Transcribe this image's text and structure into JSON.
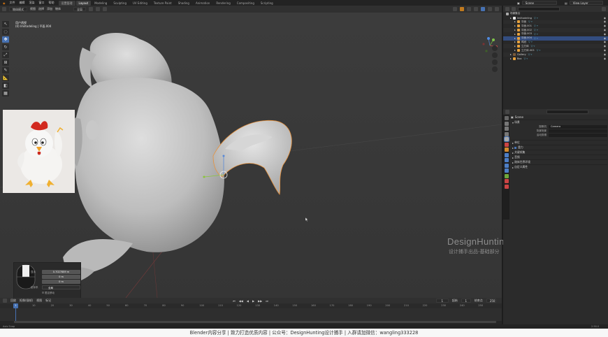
{
  "topbar": {
    "menu": [
      "文件",
      "编辑",
      "渲染",
      "窗口",
      "帮助"
    ],
    "tabs": [
      "设置管理",
      "Layout",
      "Modeling",
      "Sculpting",
      "UV Editing",
      "Texture Paint",
      "Shading",
      "Animation",
      "Rendering",
      "Compositing",
      "Scripting"
    ],
    "active_tab": "Layout",
    "scene_label": "Scene",
    "layer_label": "View Layer"
  },
  "viewport_header": {
    "mode": "物体模式",
    "menus": [
      "视图",
      "选择",
      "添加",
      "物体"
    ],
    "transform": "全局"
  },
  "viewport": {
    "info_line1": "用户透视",
    "info_line2": "(0) Imiltodeling | 平面.004",
    "watermark_title": "DesignHunting",
    "watermark_sub": "设计捕手出品-基础部分"
  },
  "op_panel": {
    "label_a": "显示",
    "value_a": "0.7027889 m",
    "value_b": "0 m",
    "value_c": "0 m",
    "label_b": "坐标系",
    "dropdown": "全局",
    "checkbox": "限定移动"
  },
  "outliner": {
    "title": "场景集合",
    "rows": [
      {
        "label": "Imiltodeling",
        "color": "#e8e8e8",
        "depth": 1
      },
      {
        "label": "平面",
        "color": "#e8a23c",
        "depth": 2
      },
      {
        "label": "平面.001",
        "color": "#e8a23c",
        "depth": 2
      },
      {
        "label": "平面.002",
        "color": "#e8a23c",
        "depth": 2
      },
      {
        "label": "平面.003",
        "color": "#e8a23c",
        "depth": 2
      },
      {
        "label": "平面.004",
        "color": "#e8a23c",
        "depth": 2,
        "selected": true
      },
      {
        "label": "鸡冠",
        "color": "#e8a23c",
        "depth": 2
      },
      {
        "label": "立方体",
        "color": "#e8a23c",
        "depth": 2
      },
      {
        "label": "立方体.003",
        "color": "#e8a23c",
        "depth": 2
      },
      {
        "label": "Gallery",
        "color": "#7a5a3a",
        "depth": 1
      },
      {
        "label": "Box",
        "color": "#e8a23c",
        "depth": 1
      }
    ]
  },
  "properties": {
    "scene_title": "Scene",
    "section_scene": "场景",
    "camera_label": "摄像机",
    "camera_value": "Camera",
    "bg_scene_label": "背景场景",
    "active_clip_label": "活动剪辑",
    "sections": [
      "单位",
      "重力",
      "关键帧集",
      "音频",
      "刚体世界环境",
      "自定义属性"
    ],
    "gravity_checked": "重力"
  },
  "timeline": {
    "menus": [
      "回放",
      "抠像(插帧)",
      "视图",
      "标记"
    ],
    "current_frame": "1",
    "start_label": "起始",
    "start_value": "1",
    "end_label": "结束点",
    "end_value": "250",
    "ticks": [
      "0",
      "20",
      "40",
      "60",
      "80",
      "100",
      "120",
      "140",
      "160",
      "180",
      "200",
      "220",
      "240"
    ],
    "ticks_all": [
      "10",
      "20",
      "30",
      "40",
      "50",
      "60",
      "70",
      "80",
      "90",
      "100",
      "110",
      "120",
      "130",
      "140",
      "150",
      "160",
      "170",
      "180",
      "190",
      "200",
      "210",
      "220",
      "230",
      "240",
      "250"
    ],
    "playhead": "1"
  },
  "statusbar": {
    "left": "Axis Snap",
    "right": "2.90.0"
  },
  "caption": "Blender内容分享  |  致力打造优质内容  |  公众号：DesignHunting设计捕手  |  入群请加微信：wangling333228",
  "colors": {
    "accent": "#4772b3",
    "selection_outline": "#e8923c",
    "viewport_bg": "#3a3a3a"
  }
}
